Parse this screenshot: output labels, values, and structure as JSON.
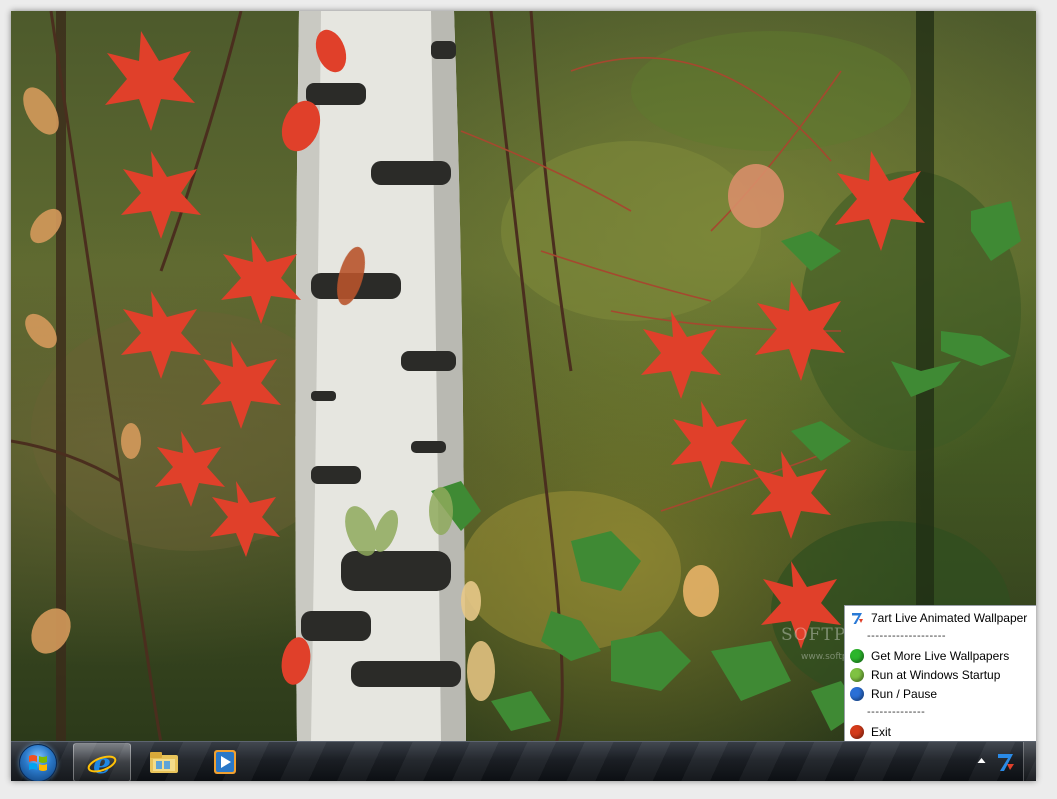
{
  "tray_menu": {
    "title": "7art Live Animated Wallpaper",
    "separator_long": "-------------------",
    "separator_short": "--------------",
    "items": [
      {
        "label": "Get More Live Wallpapers",
        "icon": "green-globe-icon",
        "color": "#2bb52b"
      },
      {
        "label": "Run at Windows Startup",
        "icon": "lime-dot-icon",
        "color": "#7fc242"
      },
      {
        "label": "Run / Pause",
        "icon": "blue-globe-icon",
        "color": "#2a6fd6"
      }
    ],
    "exit_label": "Exit",
    "exit_color": "#d43a1a"
  },
  "watermark": {
    "text": "SOFTPEDIA",
    "subtext": "www.softpedia.com"
  },
  "taskbar": {
    "start": "windows-start-orb",
    "pinned": [
      {
        "name": "internet-explorer",
        "active": true
      },
      {
        "name": "windows-explorer",
        "active": false
      },
      {
        "name": "media-player",
        "active": false
      }
    ],
    "tray_icon": "7art-tray-icon"
  },
  "colors": {
    "leaf_red": "#e0402a",
    "birch_white": "#e8e8e4",
    "taskbar_dark": "#12161b"
  }
}
